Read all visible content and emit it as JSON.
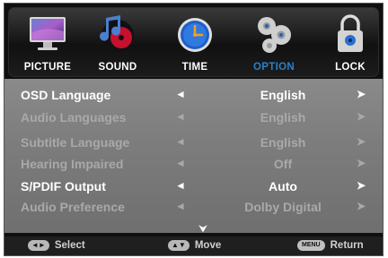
{
  "tabs": [
    {
      "label": "PICTURE",
      "icon": "picture-icon"
    },
    {
      "label": "SOUND",
      "icon": "sound-icon"
    },
    {
      "label": "TIME",
      "icon": "time-icon"
    },
    {
      "label": "OPTION",
      "icon": "option-icon",
      "active": true
    },
    {
      "label": "LOCK",
      "icon": "lock-icon"
    }
  ],
  "menu": {
    "rows": [
      {
        "label": "OSD Language",
        "value": "English",
        "enabled": true
      },
      {
        "label": "Audio Languages",
        "value": "English",
        "enabled": false
      },
      {
        "label": "Subtitle Language",
        "value": "English",
        "enabled": false
      },
      {
        "label": "Hearing Impaired",
        "value": "Off",
        "enabled": false
      },
      {
        "label": "S/PDIF Output",
        "value": "Auto",
        "enabled": true
      },
      {
        "label": "Audio Preference",
        "value": "Dolby Digital",
        "enabled": false
      }
    ],
    "left_arrow": "◄",
    "right_arrow": "➤",
    "more_indicator": "⮟"
  },
  "footer": {
    "select_keys": "◄►",
    "select_label": "Select",
    "move_keys": "▲▼",
    "move_label": "Move",
    "menu_key": "MENU",
    "return_label": "Return"
  },
  "colors": {
    "active_tab": "#2a80c8",
    "enabled_text": "#ffffff",
    "disabled_text": "#a9a9a9"
  }
}
